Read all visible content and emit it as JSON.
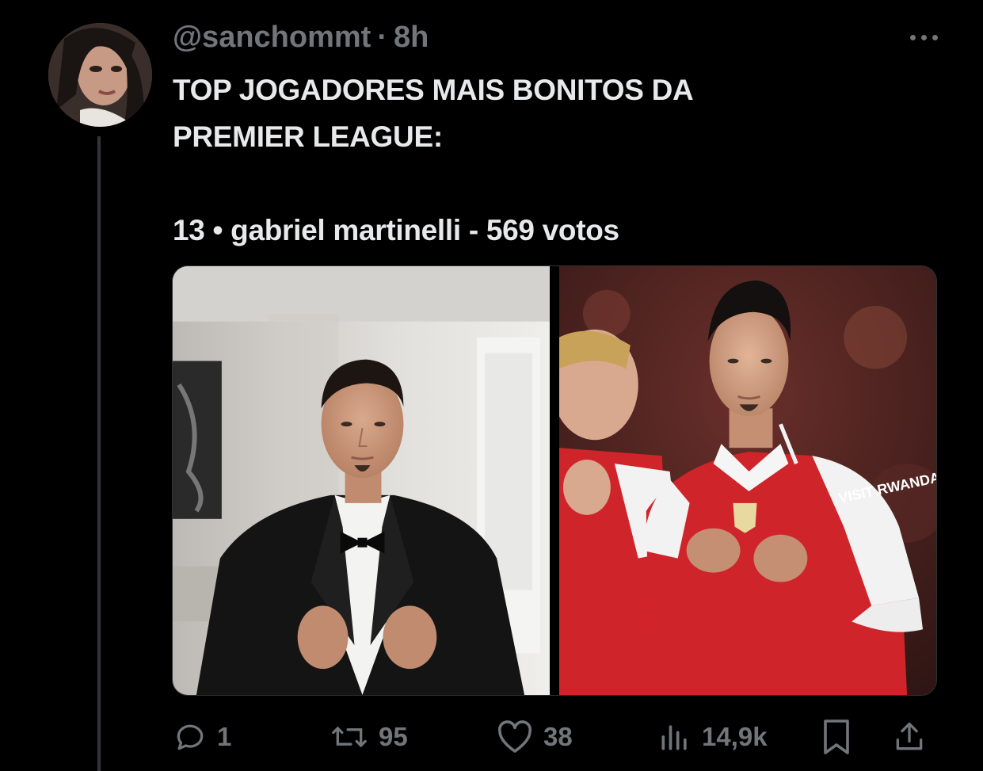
{
  "tweet": {
    "handle": "@sanchommt",
    "separator": "·",
    "time": "8h",
    "text_lines": [
      "TOP JOGADORES MAIS BONITOS DA",
      "PREMIER LEAGUE:",
      "",
      "13 • gabriel martinelli - 569 votos"
    ]
  },
  "media": {
    "left_image": "player-in-tuxedo-photo",
    "right_image": "player-in-red-jersey-photo",
    "jersey_sponsor": "VISIT RWANDA"
  },
  "actions": {
    "replies": "1",
    "reposts": "95",
    "likes": "38",
    "views": "14,9k"
  },
  "icons": {
    "reply": "reply-icon",
    "repost": "repost-icon",
    "like": "heart-icon",
    "views": "views-icon",
    "bookmark": "bookmark-icon",
    "share": "share-icon",
    "more": "more-icon"
  },
  "colors": {
    "background": "#000000",
    "text": "#e7e9ea",
    "muted": "#71767b",
    "thread_line": "#333639",
    "jersey_red": "#d0242b"
  }
}
